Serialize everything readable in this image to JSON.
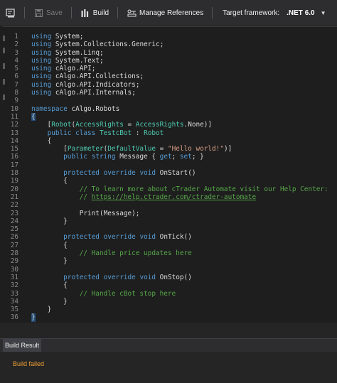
{
  "toolbar": {
    "save_label": "Save",
    "build_label": "Build",
    "manage_references_label": "Manage References",
    "target_framework_label": "Target framework:",
    "target_framework_value": ".NET 6.0",
    "icons": [
      "panel-icon",
      "save-icon",
      "build-icon",
      "manage-references-icon",
      "chevron-down-icon"
    ]
  },
  "editor": {
    "lines": [
      {
        "n": "1",
        "t": "using System;"
      },
      {
        "n": "2",
        "t": "using System.Collections.Generic;"
      },
      {
        "n": "3",
        "t": "using System.Linq;"
      },
      {
        "n": "4",
        "t": "using System.Text;"
      },
      {
        "n": "5",
        "t": "using cAlgo.API;"
      },
      {
        "n": "6",
        "t": "using cAlgo.API.Collections;"
      },
      {
        "n": "7",
        "t": "using cAlgo.API.Indicators;"
      },
      {
        "n": "8",
        "t": "using cAlgo.API.Internals;"
      },
      {
        "n": "9",
        "t": ""
      },
      {
        "n": "10",
        "t": "namespace cAlgo.Robots"
      },
      {
        "n": "11",
        "t": "{"
      },
      {
        "n": "12",
        "t": "    [Robot(AccessRights = AccessRights.None)]"
      },
      {
        "n": "13",
        "t": "    public class TestcBot : Robot"
      },
      {
        "n": "14",
        "t": "    {"
      },
      {
        "n": "15",
        "t": "        [Parameter(DefaultValue = \"Hello world!\")]"
      },
      {
        "n": "16",
        "t": "        public string Message { get; set; }"
      },
      {
        "n": "17",
        "t": ""
      },
      {
        "n": "18",
        "t": "        protected override void OnStart()"
      },
      {
        "n": "19",
        "t": "        {"
      },
      {
        "n": "20",
        "t": "            // To learn more about cTrader Automate visit our Help Center:"
      },
      {
        "n": "21",
        "t": "            // https://help.ctrader.com/ctrader-automate"
      },
      {
        "n": "22",
        "t": ""
      },
      {
        "n": "23",
        "t": "            Print(Message);"
      },
      {
        "n": "24",
        "t": "        }"
      },
      {
        "n": "25",
        "t": ""
      },
      {
        "n": "26",
        "t": "        protected override void OnTick()"
      },
      {
        "n": "27",
        "t": "        {"
      },
      {
        "n": "28",
        "t": "            // Handle price updates here"
      },
      {
        "n": "29",
        "t": "        }"
      },
      {
        "n": "30",
        "t": ""
      },
      {
        "n": "31",
        "t": "        protected override void OnStop()"
      },
      {
        "n": "32",
        "t": "        {"
      },
      {
        "n": "33",
        "t": "            // Handle cBot stop here"
      },
      {
        "n": "34",
        "t": "        }"
      },
      {
        "n": "35",
        "t": "    }"
      },
      {
        "n": "36",
        "t": "}"
      }
    ]
  },
  "panel": {
    "tab_label": "Build Result",
    "status_text": "Build failed"
  },
  "colors": {
    "keyword": "#569cd6",
    "type": "#4ec9b0",
    "string": "#d69d85",
    "comment": "#57a64a",
    "error": "#f0a030"
  }
}
